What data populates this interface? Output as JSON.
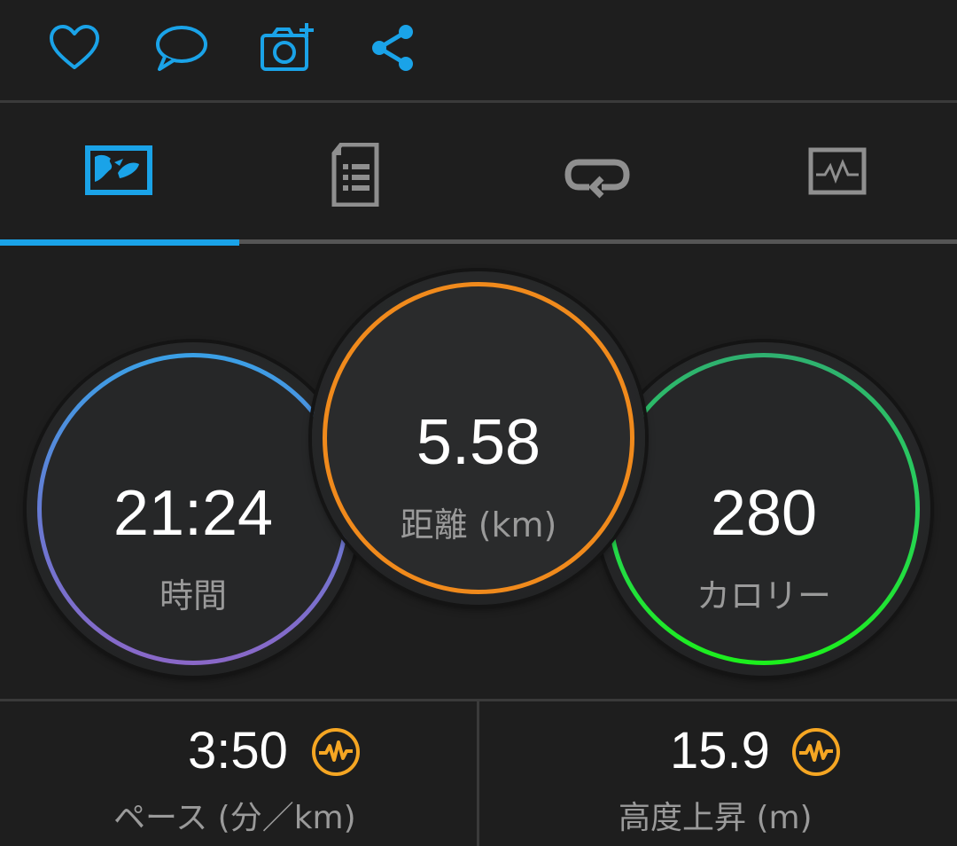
{
  "actions": {
    "like_icon": "heart-icon",
    "comment_icon": "comment-icon",
    "add_photo_icon": "camera-add-icon",
    "share_icon": "share-icon",
    "accent_color": "#1aa3e8"
  },
  "tabs": [
    {
      "icon": "map-overview-icon",
      "active": true
    },
    {
      "icon": "details-icon",
      "active": false
    },
    {
      "icon": "laps-icon",
      "active": false
    },
    {
      "icon": "charts-icon",
      "active": false
    }
  ],
  "summary": {
    "time": {
      "value": "21:24",
      "label": "時間",
      "ring_color": "#3aa0e6"
    },
    "distance": {
      "value": "5.58",
      "label": "距離 (km)",
      "ring_color": "#f08a1c"
    },
    "calories": {
      "value": "280",
      "label": "カロリー",
      "ring_color": "#1cf01c"
    }
  },
  "stats": {
    "pace": {
      "value": "3:50",
      "label": "ペース (分／km)",
      "icon": "chart-pulse-icon",
      "icon_color": "#f5a623"
    },
    "elevation_gain": {
      "value": "15.9",
      "label": "高度上昇 (m)",
      "icon": "chart-pulse-icon",
      "icon_color": "#f5a623"
    }
  }
}
